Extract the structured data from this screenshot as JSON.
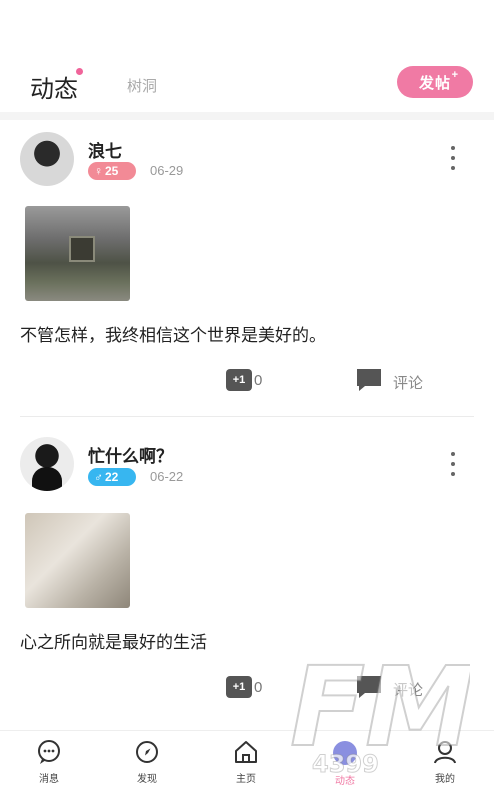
{
  "header": {
    "active_tab": "动态",
    "inactive_tab": "树洞",
    "post_button": "发帖",
    "post_button_plus": "+"
  },
  "posts": [
    {
      "username": "浪七",
      "badge_symbol": "♀",
      "badge_value": "25",
      "date": "06-29",
      "text": "不管怎样，我终相信这个世界是美好的。",
      "like_label": "+1",
      "like_count": "0",
      "comment_label": "评论"
    },
    {
      "username": "忙什么啊？",
      "badge_symbol": "♂",
      "badge_value": "22",
      "date": "06-22",
      "text": "心之所向就是最好的生活",
      "like_label": "+1",
      "like_count": "0",
      "comment_label": "评论"
    }
  ],
  "nav": {
    "items": [
      {
        "label": "消息",
        "icon": "message-icon"
      },
      {
        "label": "发现",
        "icon": "compass-icon"
      },
      {
        "label": "主页",
        "icon": "home-icon"
      },
      {
        "label": "动态",
        "icon": "moments-icon"
      },
      {
        "label": "我的",
        "icon": "profile-icon"
      }
    ]
  },
  "watermark": {
    "text_large": "FM",
    "text_small": "4399"
  },
  "colors": {
    "accent_pink": "#f07aa4",
    "badge_pink": "#f28a96",
    "badge_blue": "#37b6f0",
    "active_nav": "#8a8fe0"
  }
}
